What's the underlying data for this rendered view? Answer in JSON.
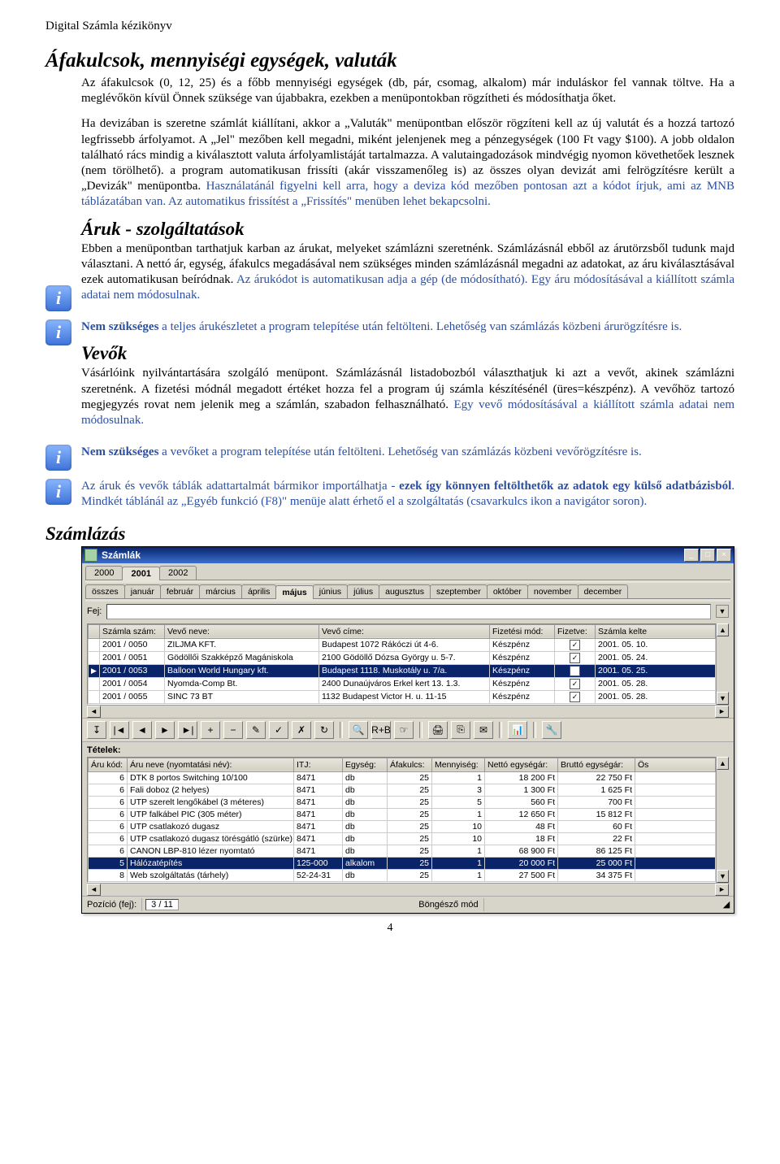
{
  "doc_header": "Digital Számla kézikönyv",
  "page_number": "4",
  "h_afa": "Áfakulcsok, mennyiségi egységek, valuták",
  "p_afa_1": "Az áfakulcsok (0, 12, 25) és a főbb mennyiségi egységek (db, pár, csomag, alkalom) már induláskor fel vannak töltve. Ha a meglévőkön kívül Önnek szüksége van újabbakra, ezekben a menüpontokban rögzítheti és módosít­hatja őket.",
  "p_afa_2a": "Ha devizában is szeretne számlát kiállítani, akkor a „Valuták\" menüpontban először rögzíteni kell az új valutát és a hozzá tartozó legfrissebb árfolyamot. A „Jel\" mezőben kell megadni, miként jelenjenek meg a pénzegységek (100 Ft vagy $100). A jobb oldalon található rács mindig a kiválasztott valuta árfolyamlistáját tartalmazza. A valutaingadozások mindvégig nyomon követhetőek lesznek (nem törölhető). a program automatikusan frissíti (akár visszamenőleg is) az összes olyan devizát ami felrögzítésre került a „Devizák\" menüpontba. ",
  "p_afa_2b": "Használatánál figyelni kell arra, hogy a deviza kód mezőben pontosan azt a kódot írjuk, ami az MNB táblázatában van. Az automatikus frissítést a „Frissítés\" menüben lehet bekapcsolni.",
  "h_aruk": "Áruk - szolgáltatások",
  "p_aruk_1a": "Ebben a menüpontban tarthatjuk karban az árukat, melyeket számlázni szeretnénk. Számlázásnál ebből az áru­törzsből tudunk majd választani. A nettó ár, egység, áfakulcs megadásával nem szükséges minden számlázásnál megadni az adatokat, az áru kiválasztásával ezek automatikusan beíródnak. ",
  "p_aruk_1b": "Az árukódot is automatikusan adja a gép (de módosítható). Egy áru módosításával a kiállított számla adatai nem módosulnak.",
  "p_aruk_2a": "Nem szükséges",
  "p_aruk_2b": " a teljes árukészletet a program telepítése után feltölteni. Lehetőség van számlázás közbeni áru­rögzítésre is.",
  "h_vevok": "Vevők",
  "p_vevok_1a": "Vásárlóink nyilvántartására szolgáló menüpont. Számlázásnál listadobozból választhatjuk ki azt a vevőt, akinek számlázni szeretnénk. A fizetési módnál megadott értéket hozza fel a program új számla készítésénél (üres=készpénz). A vevőhöz tartozó megjegyzés rovat nem jelenik meg a számlán, szabadon felhasználható. ",
  "p_vevok_1b": "Egy vevő módosításával a kiállított számla adatai nem módosulnak.",
  "p_vevok_2a": "Nem szükséges",
  "p_vevok_2b": " a vevőket a program telepítése után feltölteni. Lehetőség van számlázás közbeni vevőrögzítésre is.",
  "p_import_a": "Az áruk és vevők táblák adattartalmát bármikor importálhatja - ",
  "p_import_b": "ezek így könnyen feltölthetők az adatok egy külső adatbázisból",
  "p_import_c": ". Mindkét táblánál az „Egyéb funkció (F8)\" menüje alatt érhető el a szolgáltatás (csavarkulcs ikon a navigátor soron).",
  "h_szamlazas": "Számlázás",
  "window": {
    "title": "Számlák",
    "years": [
      "2000",
      "2001",
      "2002"
    ],
    "year_active": 1,
    "months": [
      "összes",
      "január",
      "február",
      "március",
      "április",
      "május",
      "június",
      "július",
      "augusztus",
      "szeptember",
      "október",
      "november",
      "december"
    ],
    "month_active": 5,
    "fej_label": "Fej:",
    "invoices": {
      "headers": [
        "",
        "Számla szám:",
        "Vevő neve:",
        "Vevő címe:",
        "Fizetési mód:",
        "Fizetve:",
        "Számla kelte"
      ],
      "rows": [
        {
          "sel": false,
          "num": "2001 / 0050",
          "vevo": "ZILJMA KFT.",
          "cim": "Budapest 1072 Rákóczi út 4-6.",
          "mod": "Készpénz",
          "fiz": true,
          "kelt": "2001. 05. 10."
        },
        {
          "sel": false,
          "num": "2001 / 0051",
          "vevo": "Gödöllői Szakképző Magániskola",
          "cim": "2100 Gödöllő Dózsa György u. 5-7.",
          "mod": "Készpénz",
          "fiz": true,
          "kelt": "2001. 05. 24."
        },
        {
          "sel": true,
          "num": "2001 / 0053",
          "vevo": "Balloon World Hungary kft.",
          "cim": "Budapest 1118. Muskotály u. 7/a.",
          "mod": "Készpénz",
          "fiz": true,
          "kelt": "2001. 05. 25."
        },
        {
          "sel": false,
          "num": "2001 / 0054",
          "vevo": "Nyomda-Comp Bt.",
          "cim": "2400 Dunaújváros Erkel kert 13. 1.3.",
          "mod": "Készpénz",
          "fiz": true,
          "kelt": "2001. 05. 28."
        },
        {
          "sel": false,
          "num": "2001 / 0055",
          "vevo": "SINC 73 BT",
          "cim": "1132 Budapest Victor H. u. 11-15",
          "mod": "Készpénz",
          "fiz": true,
          "kelt": "2001. 05. 28."
        }
      ]
    },
    "tetelek_label": "Tételek:",
    "items": {
      "headers": [
        "Áru kód:",
        "Áru neve (nyomtatási név):",
        "ITJ:",
        "Egység:",
        "Áfakulcs:",
        "Mennyiség:",
        "Nettó egységár:",
        "Bruttó egységár:",
        "Ös"
      ],
      "rows": [
        {
          "kod": "6",
          "nev": "DTK 8 portos Switching 10/100",
          "itj": "8471",
          "egy": "db",
          "afa": "25",
          "menny": "1",
          "netto": "18 200 Ft",
          "brutto": "22 750 Ft",
          "sel": false
        },
        {
          "kod": "6",
          "nev": "Fali doboz (2 helyes)",
          "itj": "8471",
          "egy": "db",
          "afa": "25",
          "menny": "3",
          "netto": "1 300 Ft",
          "brutto": "1 625 Ft",
          "sel": false
        },
        {
          "kod": "6",
          "nev": "UTP szerelt lengőkábel (3 méteres)",
          "itj": "8471",
          "egy": "db",
          "afa": "25",
          "menny": "5",
          "netto": "560 Ft",
          "brutto": "700 Ft",
          "sel": false
        },
        {
          "kod": "6",
          "nev": "UTP falkábel PIC (305 méter)",
          "itj": "8471",
          "egy": "db",
          "afa": "25",
          "menny": "1",
          "netto": "12 650 Ft",
          "brutto": "15 812 Ft",
          "sel": false
        },
        {
          "kod": "6",
          "nev": "UTP csatlakozó dugasz",
          "itj": "8471",
          "egy": "db",
          "afa": "25",
          "menny": "10",
          "netto": "48 Ft",
          "brutto": "60 Ft",
          "sel": false
        },
        {
          "kod": "6",
          "nev": "UTP csatlakozó dugasz törésgátló (szürke)",
          "itj": "8471",
          "egy": "db",
          "afa": "25",
          "menny": "10",
          "netto": "18 Ft",
          "brutto": "22 Ft",
          "sel": false
        },
        {
          "kod": "6",
          "nev": "CANON LBP-810 lézer nyomtató",
          "itj": "8471",
          "egy": "db",
          "afa": "25",
          "menny": "1",
          "netto": "68 900 Ft",
          "brutto": "86 125 Ft",
          "sel": false
        },
        {
          "kod": "5",
          "nev": "Hálózatépítés",
          "itj": "125-000",
          "egy": "alkalom",
          "afa": "25",
          "menny": "1",
          "netto": "20 000 Ft",
          "brutto": "25 000 Ft",
          "sel": true
        },
        {
          "kod": "8",
          "nev": "Web szolgáltatás (tárhely)",
          "itj": "52-24-31",
          "egy": "db",
          "afa": "25",
          "menny": "1",
          "netto": "27 500 Ft",
          "brutto": "34 375 Ft",
          "sel": false
        }
      ]
    },
    "toolbar_icons": [
      "↧",
      "|◄",
      "◄",
      "►",
      "►|",
      "+",
      "−",
      "✎",
      "✓",
      "✗",
      "↻",
      "—",
      "🔍",
      "R+B",
      "☞",
      "—",
      "🖨",
      "⎘",
      "✉",
      "—",
      "📊",
      "—",
      "🔧"
    ],
    "status": {
      "pos_label": "Pozíció (fej):",
      "pos_value": "3 / 11",
      "mode": "Böngésző mód"
    }
  }
}
